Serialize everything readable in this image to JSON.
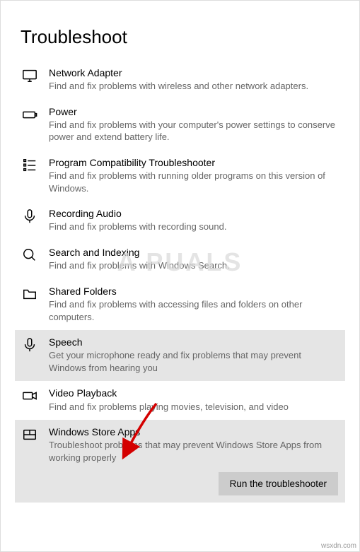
{
  "page": {
    "title": "Troubleshoot"
  },
  "items": [
    {
      "key": "network-adapter",
      "title": "Network Adapter",
      "desc": "Find and fix problems with wireless and other network adapters.",
      "highlight": false
    },
    {
      "key": "power",
      "title": "Power",
      "desc": "Find and fix problems with your computer's power settings to conserve power and extend battery life.",
      "highlight": false
    },
    {
      "key": "program-compatibility",
      "title": "Program Compatibility Troubleshooter",
      "desc": "Find and fix problems with running older programs on this version of Windows.",
      "highlight": false
    },
    {
      "key": "recording-audio",
      "title": "Recording Audio",
      "desc": "Find and fix problems with recording sound.",
      "highlight": false
    },
    {
      "key": "search-indexing",
      "title": "Search and Indexing",
      "desc": "Find and fix problems with Windows Search.",
      "highlight": false
    },
    {
      "key": "shared-folders",
      "title": "Shared Folders",
      "desc": "Find and fix problems with accessing files and folders on other computers.",
      "highlight": false
    },
    {
      "key": "speech",
      "title": "Speech",
      "desc": "Get your microphone ready and fix problems that may prevent Windows from hearing you",
      "highlight": true
    },
    {
      "key": "video-playback",
      "title": "Video Playback",
      "desc": "Find and fix problems playing movies, television, and video",
      "highlight": false
    },
    {
      "key": "windows-store-apps",
      "title": "Windows Store Apps",
      "desc": "Troubleshoot problems that may prevent Windows Store Apps from working properly",
      "highlight": true,
      "selected": true
    }
  ],
  "button": {
    "run": "Run the troubleshooter"
  },
  "watermark": "A PUALS",
  "footer": "wsxdn.com"
}
